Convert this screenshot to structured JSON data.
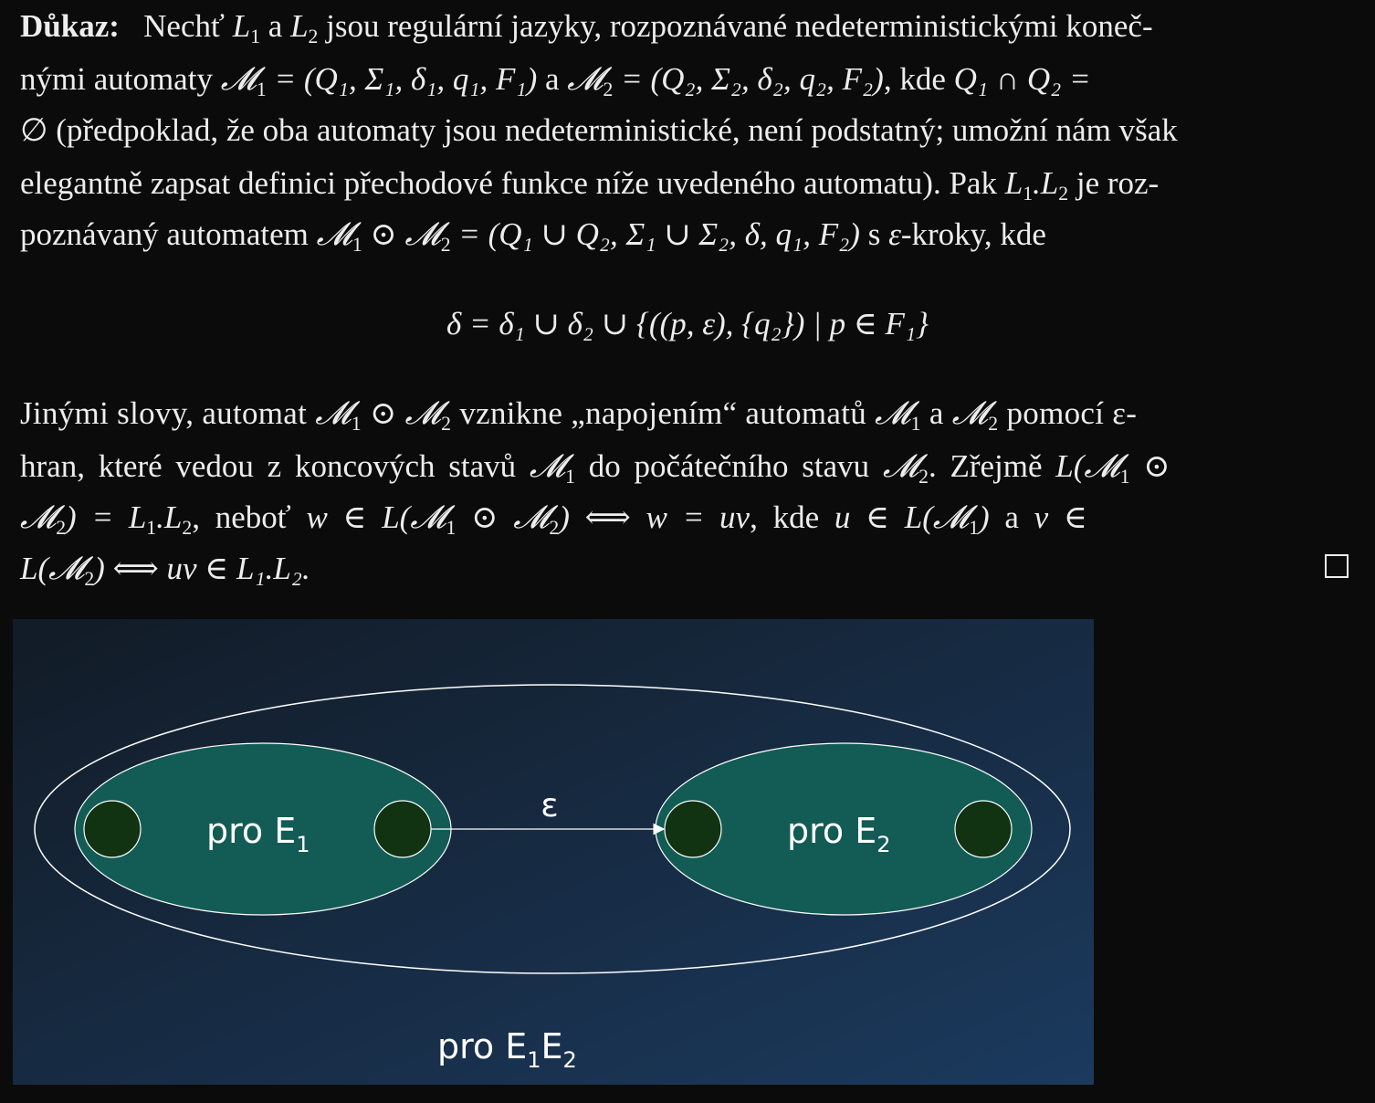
{
  "proof": {
    "label": "Důkaz:",
    "line1": {
      "a": "Nechť ",
      "b": " a ",
      "c": " jsou regulární jazyky, rozpoznávané nedeterministickými koneč-"
    },
    "line2": {
      "a": "nými automaty ",
      "m1": "(Q₁, Σ₁, δ₁, q₁, F₁)",
      "b": " a ",
      "m2": "(Q₂, Σ₂, δ₂, q₂, F₂)",
      "c": ", kde ",
      "d": "Q₁ ∩ Q₂ ="
    },
    "line3": "∅ (předpoklad, že oba automaty jsou nedeterministické, není podstatný; umožní nám však",
    "line4": {
      "a": "elegantně zapsat definici přechodové funkce níže uvedeného automatu). Pak ",
      "b": " je roz-"
    },
    "line5": {
      "a": "poznávaný automatem ",
      "tuple": "(Q₁ ∪ Q₂, Σ₁ ∪ Σ₂, δ, q₁, F₂)",
      "b": " s ",
      "c": "ε",
      "d": "-kroky, kde"
    },
    "display": "δ = δ₁ ∪ δ₂ ∪ {((p, ε), {q₂}) | p ∈ F₁}",
    "para2": {
      "line1a": "Jinými slovy, automat ",
      "line1b": " vznikne „napojením“ automatů ",
      "line1c": " a ",
      "line1d": " pomocí ε-",
      "line2a": "hran, které vedou z koncových stavů ",
      "line2b": " do počátečního stavu ",
      "line2c": ". Zřejmě ",
      "line3a": "), neboť ",
      "line3b": "w = uv",
      "line3c": ", kde ",
      "line3d": " a ",
      "line4": "uv ∈ L₁.L₂."
    }
  },
  "diagram": {
    "epsilon_label": "ε",
    "left_label": "pro E",
    "left_sub": "1",
    "right_label": "pro E",
    "right_sub": "2",
    "outer_label_a": "pro E",
    "outer_sub_a": "1",
    "outer_label_b": "E",
    "outer_sub_b": "2",
    "colors": {
      "background_from": "#121b26",
      "background_to": "#1b3a5e",
      "inner_ellipse": "#125c55",
      "state": "#113312"
    }
  }
}
